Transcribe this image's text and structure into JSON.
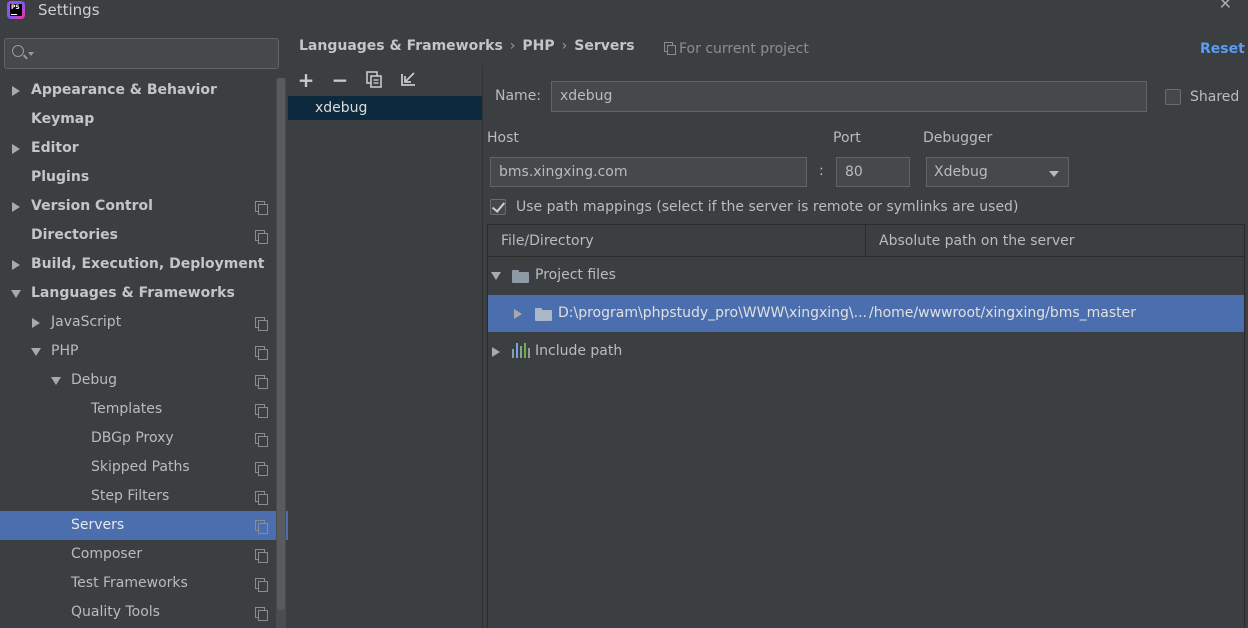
{
  "window": {
    "title": "Settings",
    "app_icon_text": "PS",
    "close_glyph": "✕"
  },
  "search": {
    "value": "",
    "placeholder": ""
  },
  "tree": [
    {
      "label": "Appearance & Behavior",
      "bold": true,
      "arrow": "right",
      "project_icon": false
    },
    {
      "label": "Keymap",
      "bold": true,
      "arrow": "none",
      "project_icon": false
    },
    {
      "label": "Editor",
      "bold": true,
      "arrow": "right",
      "project_icon": false
    },
    {
      "label": "Plugins",
      "bold": true,
      "arrow": "none",
      "project_icon": false
    },
    {
      "label": "Version Control",
      "bold": true,
      "arrow": "right",
      "project_icon": true
    },
    {
      "label": "Directories",
      "bold": true,
      "arrow": "none",
      "project_icon": true
    },
    {
      "label": "Build, Execution, Deployment",
      "bold": true,
      "arrow": "right",
      "project_icon": false
    },
    {
      "label": "Languages & Frameworks",
      "bold": true,
      "arrow": "down",
      "project_icon": false
    },
    {
      "label": "JavaScript",
      "bold": false,
      "arrow": "right",
      "project_icon": true
    },
    {
      "label": "PHP",
      "bold": false,
      "arrow": "down",
      "project_icon": true
    },
    {
      "label": "Debug",
      "bold": false,
      "arrow": "down",
      "project_icon": true
    },
    {
      "label": "Templates",
      "bold": false,
      "arrow": "none",
      "project_icon": true
    },
    {
      "label": "DBGp Proxy",
      "bold": false,
      "arrow": "none",
      "project_icon": true
    },
    {
      "label": "Skipped Paths",
      "bold": false,
      "arrow": "none",
      "project_icon": true
    },
    {
      "label": "Step Filters",
      "bold": false,
      "arrow": "none",
      "project_icon": true
    },
    {
      "label": "Servers",
      "bold": false,
      "arrow": "none",
      "project_icon": true,
      "selected": true
    },
    {
      "label": "Composer",
      "bold": false,
      "arrow": "none",
      "project_icon": true
    },
    {
      "label": "Test Frameworks",
      "bold": false,
      "arrow": "none",
      "project_icon": true
    },
    {
      "label": "Quality Tools",
      "bold": false,
      "arrow": "none",
      "project_icon": true
    }
  ],
  "breadcrumb": {
    "items": [
      "Languages & Frameworks",
      "PHP",
      "Servers"
    ],
    "separator": "›",
    "scope_label": "For current project",
    "reset_label": "Reset"
  },
  "toolbar": {
    "add": "+",
    "remove": "−",
    "copy": "copy",
    "import": "import"
  },
  "servers": [
    {
      "name": "xdebug",
      "selected": true
    }
  ],
  "form": {
    "name_label": "Name:",
    "name_value": "xdebug",
    "shared_label": "Shared",
    "shared_checked": false,
    "host_label": "Host",
    "host_value": "bms.xingxing.com",
    "port_separator": ":",
    "port_label": "Port",
    "port_value": "80",
    "debugger_label": "Debugger",
    "debugger_value": "Xdebug",
    "path_mapping_label": "Use path mappings (select if the server is remote or symlinks are used)",
    "path_mapping_checked": true
  },
  "mapping_table": {
    "columns": [
      "File/Directory",
      "Absolute path on the server"
    ],
    "rows": [
      {
        "file": "Project files",
        "server_path": "",
        "expanded": true,
        "icon": "folder-icon",
        "selected": false
      },
      {
        "file": "D:\\program\\phpstudy_pro\\WWW\\xingxing\\...",
        "server_path": "/home/wwwroot/xingxing/bms_master",
        "expanded": false,
        "icon": "folder-icon",
        "selected": true
      },
      {
        "file": "Include path",
        "server_path": "",
        "expanded": false,
        "icon": "library-icon",
        "selected": false
      }
    ]
  },
  "colors": {
    "background": "#3c3f41",
    "selection": "#4b6eaf",
    "list_selection": "#0d293e",
    "link": "#589df6"
  }
}
